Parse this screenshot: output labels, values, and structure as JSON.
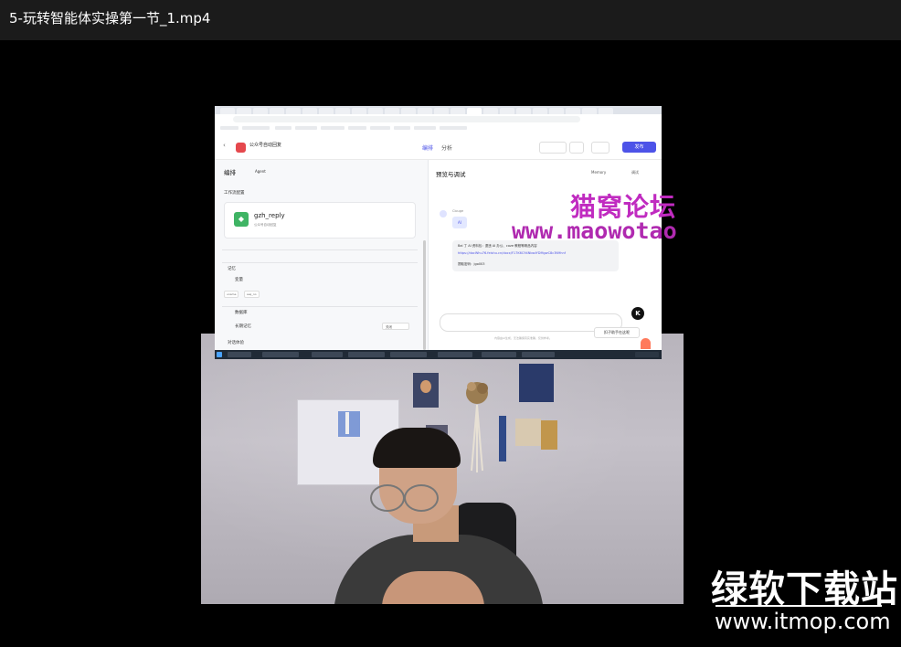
{
  "window": {
    "title": "5-玩转智能体实操第一节_1.mp4"
  },
  "screen": {
    "app": {
      "name": "公众号自动回复",
      "tags": "",
      "tab_edit": "编排",
      "tab_analyze": "分析",
      "publish": "发布"
    },
    "left_panel": {
      "title": "编排",
      "mode": "Agent",
      "workflow_section": "工作流配置",
      "workflow_name": "gzh_reply",
      "workflow_desc": "公众号自动回复",
      "memory_title": "记忆",
      "variables": "变量",
      "chips": [
        "uname",
        "seq_no"
      ],
      "database": "数据库",
      "long_memory": "长期记忆",
      "long_memory_value": "关闭",
      "settings_title": "对话体验"
    },
    "right_panel": {
      "title": "预览与调试",
      "memory": "Memory",
      "debug": "调试",
      "bot_name": "Clouge",
      "ai_label": "AI",
      "message_line1": "Bai 丁 AI 资料包：退违 AI 办公、coze 教程等精品内容",
      "message_link": "https://docWhu76.feishu.cn/docx/F17K6C94NbsdYDMgwC8c3N9hnf",
      "message_line3": "提取密码：jgo003",
      "chat_hint": "内容由AI生成，无法确保真实准确，仅供参考。",
      "tooltip": "扣子助手在这呢"
    }
  },
  "watermarks": {
    "site_cn": "猫窝论坛",
    "site_url": "www.maowotao",
    "brand_cn": "绿软下载站",
    "brand_url": "www.itmop.com"
  }
}
